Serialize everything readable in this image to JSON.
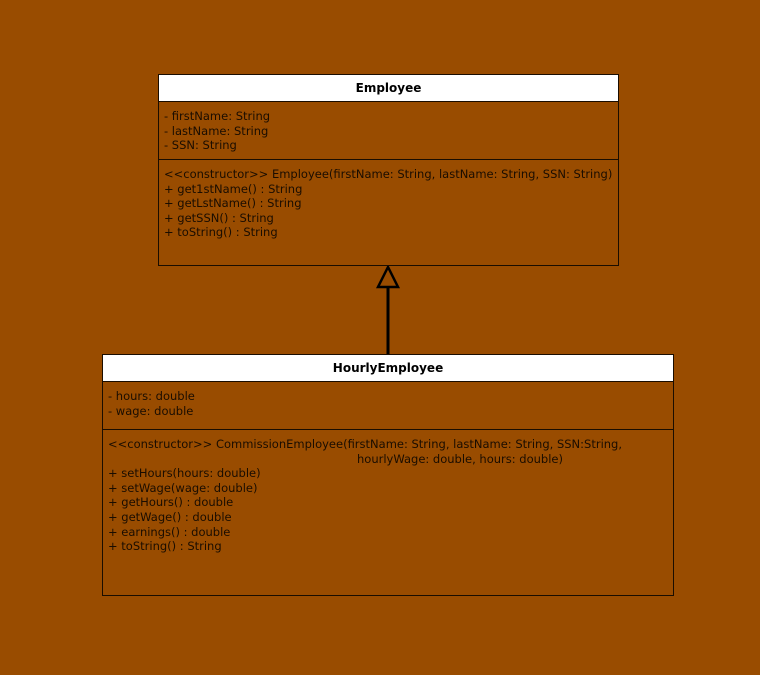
{
  "employee": {
    "name": "Employee",
    "attributes": [
      "- firstName: String",
      "- lastName: String",
      "- SSN: String"
    ],
    "operations": [
      "<<constructor>> Employee(firstName: String, lastName: String, SSN: String)",
      "+ get1stName() : String",
      "+ getLstName() : String",
      "+ getSSN() : String",
      "+ toString() : String"
    ]
  },
  "hourly_employee": {
    "name": "HourlyEmployee",
    "attributes": [
      "- hours: double",
      "- wage: double"
    ],
    "constructor_line1": "<<constructor>> CommissionEmployee(firstName: String, lastName: String, SSN:String,",
    "constructor_line2": "hourlyWage: double, hours: double)",
    "operations": [
      "+ setHours(hours: double)",
      "+ setWage(wage: double)",
      "+ getHours() : double",
      "+ getWage() : double",
      "+ earnings() : double",
      "+ toString() : String"
    ]
  },
  "relationship": {
    "type": "generalization",
    "from": "HourlyEmployee",
    "to": "Employee"
  },
  "colors": {
    "background": "#994c00",
    "header": "#ffffff",
    "line": "#1a0d00"
  }
}
